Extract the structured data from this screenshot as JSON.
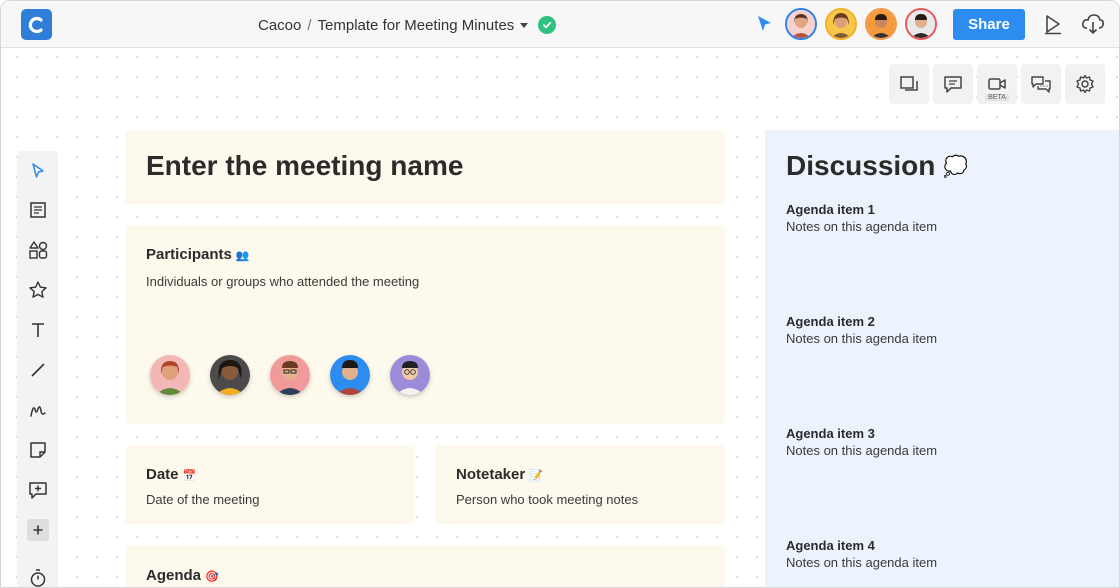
{
  "header": {
    "workspace": "Cacoo",
    "separator": "/",
    "doc_title": "Template for Meeting Minutes",
    "share_label": "Share",
    "collaborators": [
      {
        "name": "collaborator-1",
        "ring": "#2f80ed"
      },
      {
        "name": "collaborator-2",
        "ring": "#f2b01e"
      },
      {
        "name": "collaborator-3",
        "ring": "#f2994a"
      },
      {
        "name": "collaborator-4",
        "ring": "#eb5757"
      }
    ]
  },
  "right_toolbar": {
    "beta_badge": "BETA"
  },
  "meeting": {
    "name": "Enter the meeting name",
    "participants_title": "Participants",
    "participants_emoji": "👥",
    "participants_desc": "Individuals or groups who attended the meeting",
    "date_title": "Date",
    "date_emoji": "📅",
    "date_desc": "Date of the meeting",
    "notetaker_title": "Notetaker",
    "notetaker_emoji": "📝",
    "notetaker_desc": "Person who took meeting notes",
    "agenda_title": "Agenda",
    "agenda_emoji": "🎯"
  },
  "discussion": {
    "title": "Discussion",
    "emoji": "💭",
    "items": [
      {
        "title": "Agenda item 1",
        "note": "Notes on this agenda item"
      },
      {
        "title": "Agenda item 2",
        "note": "Notes on this agenda item"
      },
      {
        "title": "Agenda item 3",
        "note": "Notes on this agenda item"
      },
      {
        "title": "Agenda item 4",
        "note": "Notes on this agenda item"
      }
    ]
  },
  "colors": {
    "accent": "#2d8cf0",
    "card_bg": "#fdf9ec",
    "discussion_bg": "#edf3fd",
    "status_ok": "#2ec27e"
  }
}
